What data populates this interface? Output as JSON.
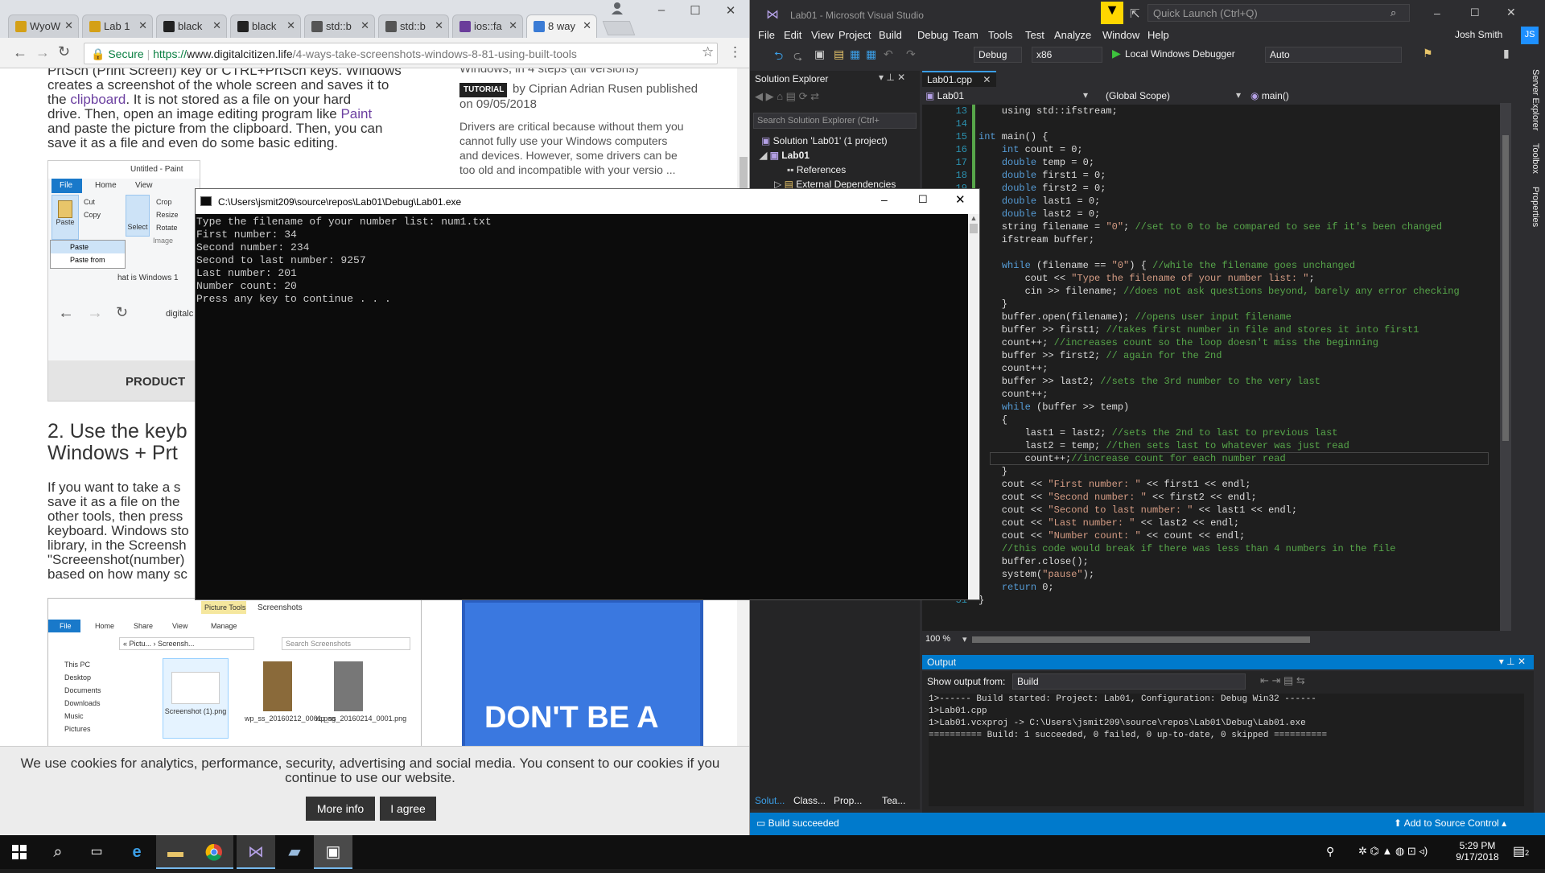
{
  "browser": {
    "tabs": [
      {
        "label": "WyoW",
        "icon": "wyoming-icon",
        "color": "#d4a017"
      },
      {
        "label": "Lab 1",
        "icon": "wyoming-icon",
        "color": "#d4a017"
      },
      {
        "label": "black",
        "icon": "github-icon",
        "color": "#222222"
      },
      {
        "label": "black",
        "icon": "github-icon",
        "color": "#222222"
      },
      {
        "label": "std::b",
        "icon": "cpp-icon",
        "color": "#555555"
      },
      {
        "label": "std::b",
        "icon": "cpp-icon",
        "color": "#555555"
      },
      {
        "label": "ios::fa",
        "icon": "site-icon",
        "color": "#6a3d9a"
      },
      {
        "label": "8 way",
        "icon": "digitalcitizen-icon",
        "color": "#3a7bd5"
      }
    ],
    "secure_label": "Secure",
    "url_scheme": "https://",
    "url_host": "www.digitalcitizen.life",
    "url_path": "/4-ways-take-screenshots-windows-8-81-using-built-tools",
    "article": {
      "intro_top": "PrtScn (Print Screen) key or CTRL+PrtScn keys. Windows",
      "intro_lines": [
        "creates a screenshot of the whole screen and saves it to",
        "the ",
        "drive. Then, open an image editing program like ",
        "and paste the picture from the clipboard. Then, you can",
        "save it as a file and even do some basic editing."
      ],
      "link_clipboard": "clipboard",
      "intro_after_clipboard": ". It is not stored as a file on your hard",
      "link_paint": "Paint",
      "heading_lines": [
        "2. Use the keyb",
        "Windows + Prt"
      ],
      "para2": [
        "If you want to take a s",
        "save it as a file on the",
        "other tools, then press",
        "keyboard. Windows sto",
        "library, in the Screensh",
        "\"Screeenshot(number)",
        "based on how many sc"
      ],
      "side_title": "Windows, in 4 steps (all versions)",
      "tutorial_badge": "TUTORIAL",
      "byline": "by Ciprian Adrian Rusen published",
      "date": "on 09/05/2018",
      "side_text": [
        "Drivers are critical because without them you",
        "cannot fully use your Windows computers",
        "and devices. However, some drivers can be",
        "too old and incompatible with your versio"
      ],
      "side_more": "...",
      "paint": {
        "title": "Untitled - Paint",
        "tabs": [
          "File",
          "Home",
          "View"
        ],
        "clipboard_items": [
          "Cut",
          "Copy"
        ],
        "paste": "Paste",
        "select": "Select",
        "image_items": [
          "Crop",
          "Resize",
          "Rotate"
        ],
        "image_group": "Image",
        "menu": [
          "Paste",
          "Paste from"
        ],
        "behind_text": "hat is Windows 1",
        "behind_url": "digitalc",
        "product": "PRODUCT"
      },
      "explorer": {
        "tab_picture_tools": "Picture Tools",
        "title": "Screenshots",
        "tabs": [
          "File",
          "Home",
          "Share",
          "View",
          "Manage"
        ],
        "path": "« Pictu... › Screensh...",
        "search": "Search Screenshots",
        "nav": [
          "This PC",
          "Desktop",
          "Documents",
          "Downloads",
          "Music",
          "Pictures"
        ],
        "files": [
          "Screenshot (1).png",
          "wp_ss_20160212_0001.png",
          "wp_ss_20160214_0001.png"
        ]
      },
      "ad_text": "DON'T BE A"
    },
    "cookie": {
      "text": "We use cookies for analytics, performance, security, advertising and social media. You consent to our cookies if you continue to use our website.",
      "more_info": "More info",
      "agree": "I agree"
    }
  },
  "console": {
    "title": "C:\\Users\\jsmit209\\source\\repos\\Lab01\\Debug\\Lab01.exe",
    "lines": [
      "Type the filename of your number list: num1.txt",
      "First number: 34",
      "Second number: 234",
      "Second to last number: 9257",
      "Last number: 201",
      "Number count: 20",
      "Press any key to continue . . ."
    ]
  },
  "vs": {
    "title": "Lab01 - Microsoft Visual Studio",
    "quick_launch": "Quick Launch (Ctrl+Q)",
    "menu": [
      "File",
      "Edit",
      "View",
      "Project",
      "Build",
      "Debug",
      "Team",
      "Tools",
      "Test",
      "Analyze",
      "Window",
      "Help"
    ],
    "user": "Josh Smith",
    "user_initials": "JS",
    "config": "Debug",
    "platform": "x86",
    "run": "Local Windows Debugger",
    "run_mode": "Auto",
    "solution_explorer": {
      "title": "Solution Explorer",
      "search": "Search Solution Explorer (Ctrl+",
      "items": [
        "Solution 'Lab01' (1 project)",
        "Lab01",
        "References",
        "External Dependencies"
      ],
      "bottom_tabs": [
        "Solut...",
        "Class...",
        "Prop...",
        "Tea..."
      ]
    },
    "editor": {
      "tab": "Lab01.cpp",
      "scope_file": "Lab01",
      "scope": "(Global Scope)",
      "member": "main()",
      "zoom": "100 %"
    },
    "right_tabs": [
      "Server Explorer",
      "Toolbox",
      "Properties"
    ],
    "output": {
      "title": "Output",
      "show_from_label": "Show output from:",
      "show_from": "Build",
      "lines": [
        "1>------ Build started: Project: Lab01, Configuration: Debug Win32 ------",
        "1>Lab01.cpp",
        "1>Lab01.vcxproj -> C:\\Users\\jsmit209\\source\\repos\\Lab01\\Debug\\Lab01.exe",
        "========== Build: 1 succeeded, 0 failed, 0 up-to-date, 0 skipped =========="
      ]
    },
    "status": "Build succeeded",
    "source_control": "Add to Source Control"
  },
  "taskbar": {
    "time": "5:29 PM",
    "date": "9/17/2018",
    "notification_count": "2"
  }
}
